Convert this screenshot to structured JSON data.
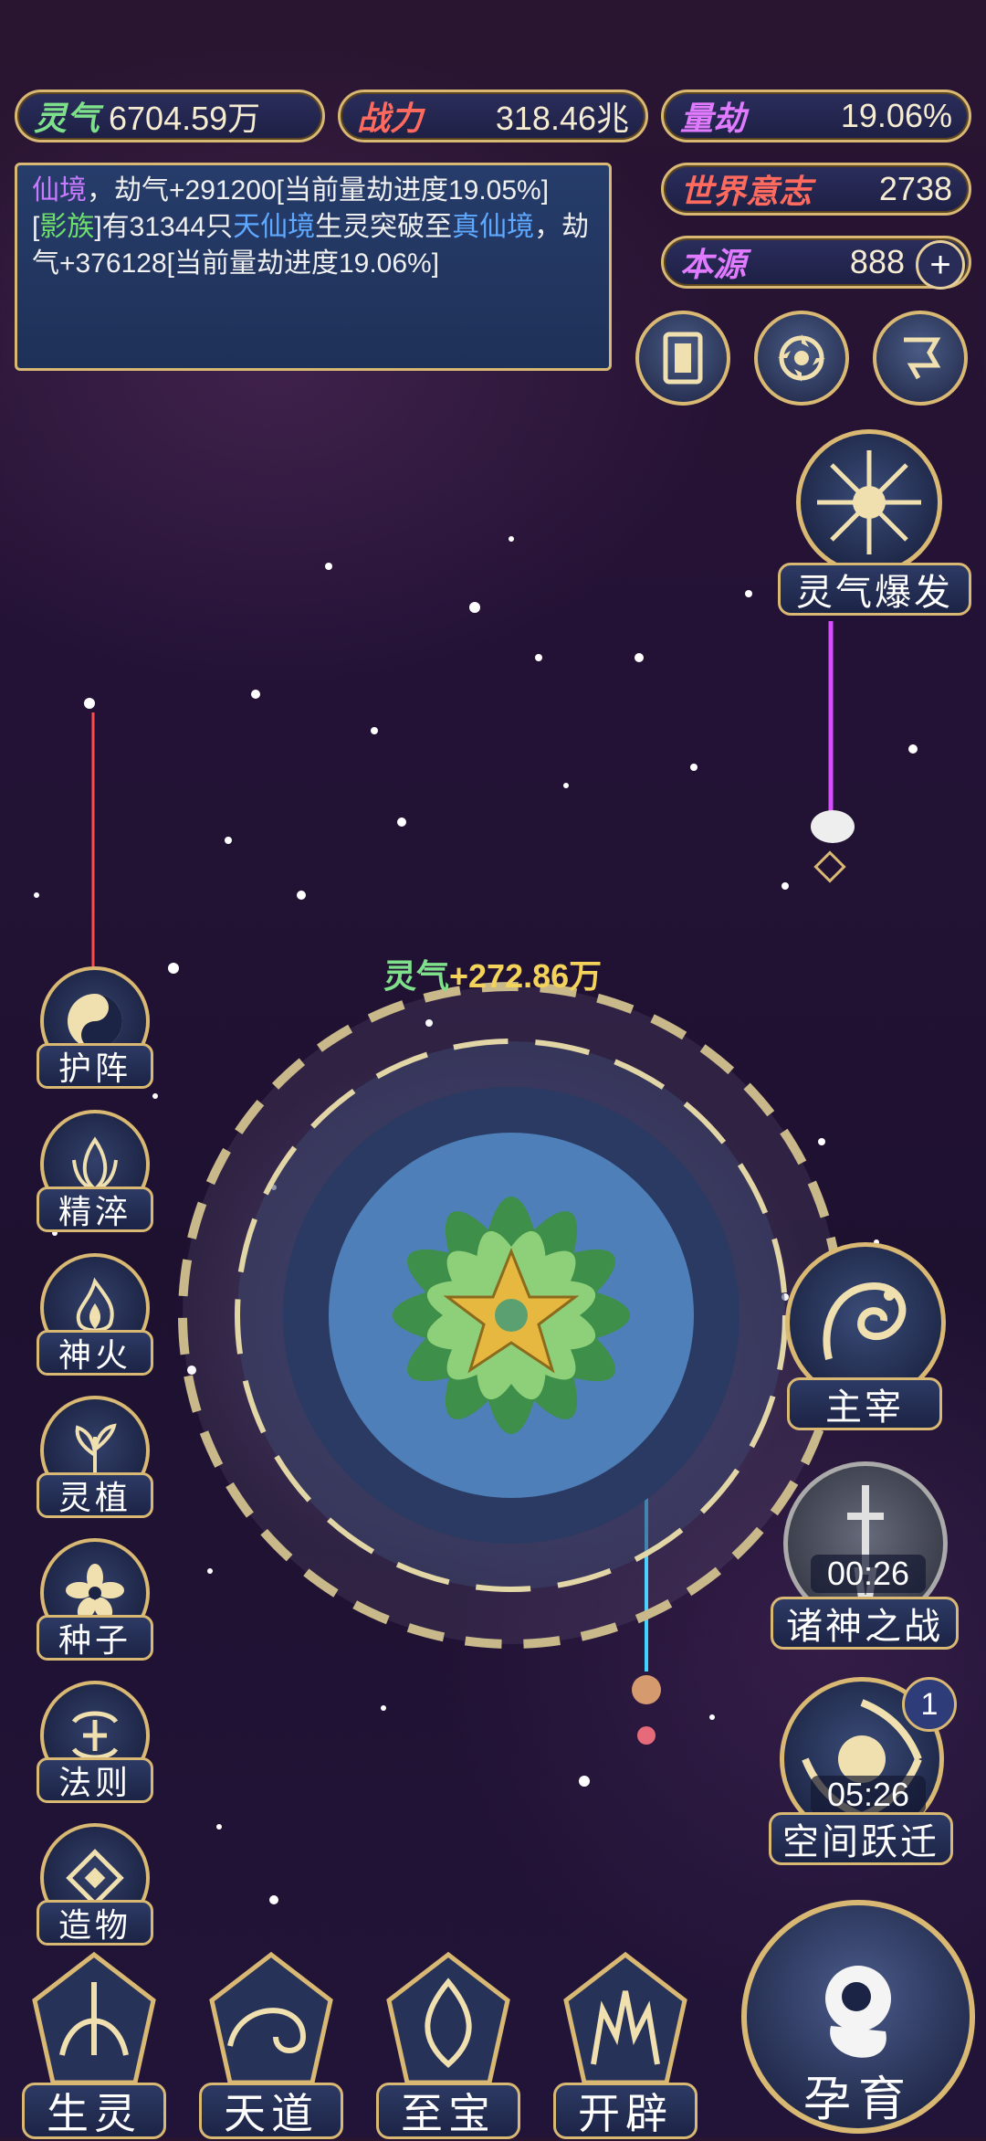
{
  "stats": {
    "lingqi_label": "灵气",
    "lingqi_value": "6704.59万",
    "zhanli_label": "战力",
    "zhanli_value": "318.46兆",
    "liangjie_label": "量劫",
    "liangjie_value": "19.06%",
    "shijie_label": "世界意志",
    "shijie_value": "2738",
    "benyuan_label": "本源",
    "benyuan_value": "888",
    "plus": "+"
  },
  "log": {
    "line1_a": "仙境",
    "line1_b": "，劫气+291200[当前量劫进度19.05%]",
    "line2_a": "[",
    "line2_b": "影族",
    "line2_c": "]有31344只",
    "line2_d": "天仙境",
    "line2_e": "生灵突破至",
    "line2_f": "真仙境",
    "line2_g": "，劫气+376128[当前量劫进度19.06%]"
  },
  "gain": {
    "label": "灵气",
    "value": "+272.86万"
  },
  "left_skills": [
    "护阵",
    "精淬",
    "神火",
    "灵植",
    "种子",
    "法则",
    "造物"
  ],
  "right_buttons": {
    "burst": "灵气爆发",
    "master": "主宰",
    "gods_timer": "00:26",
    "gods": "诸神之战",
    "space_timer": "05:26",
    "space": "空间跃迁",
    "space_badge": "1",
    "breed": "孕育"
  },
  "bottom_menu": [
    "生灵",
    "天道",
    "至宝",
    "开辟"
  ],
  "colors": {
    "gold": "#d8b873",
    "panel": "#1e3158",
    "accent_green": "#7ee08a"
  }
}
